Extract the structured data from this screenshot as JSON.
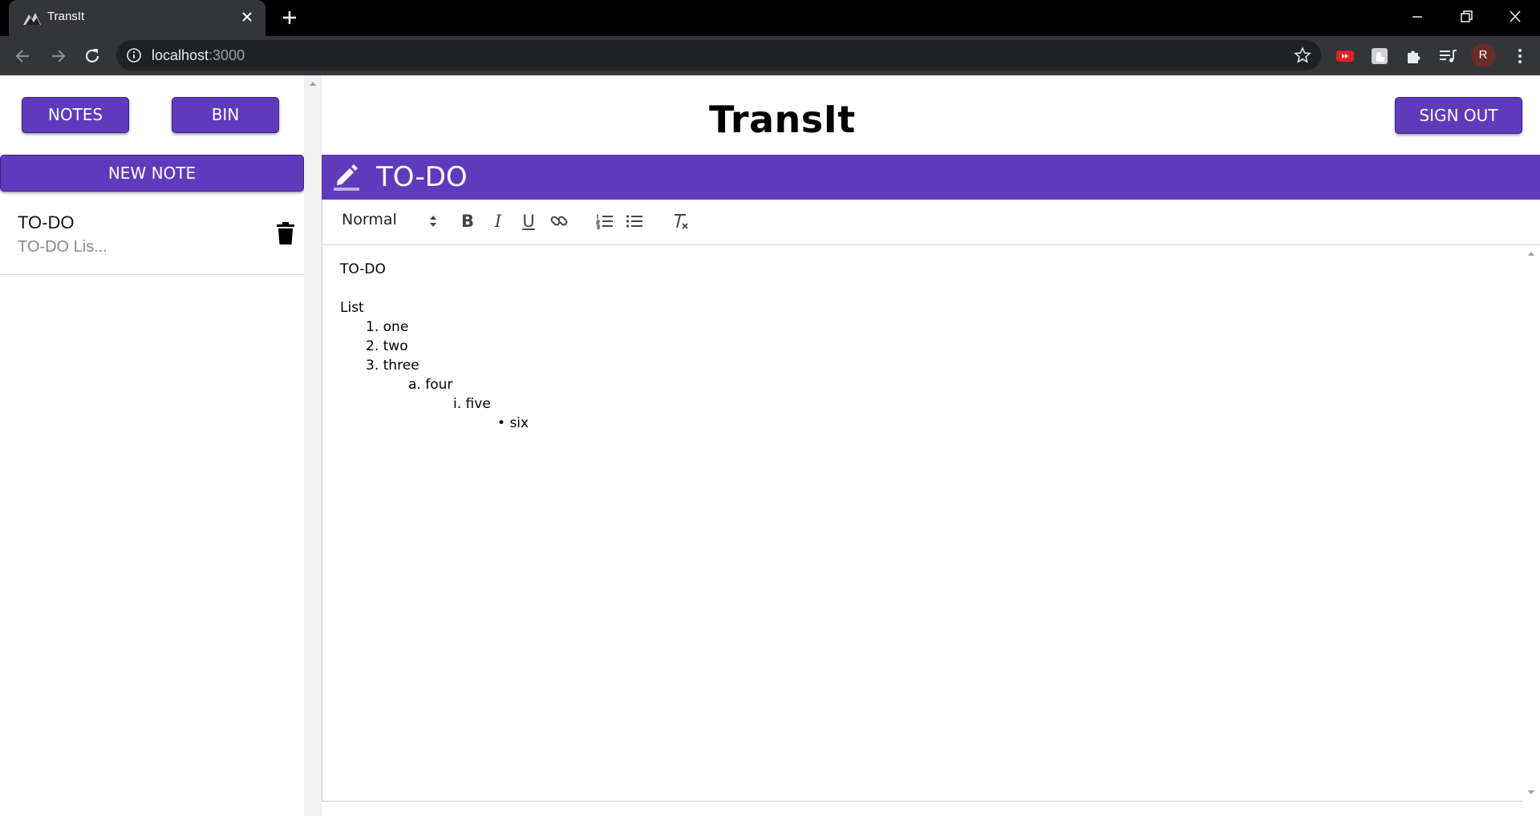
{
  "browser": {
    "tab_title": "TransIt",
    "url_host": "localhost",
    "url_port": ":3000",
    "profile_initial": "R",
    "icons": [
      "tab-favicon",
      "close-icon",
      "plus-icon",
      "minimize-icon",
      "restore-icon",
      "window-close-icon",
      "back-icon",
      "forward-icon",
      "reload-icon",
      "info-icon",
      "star-icon",
      "youtube-extension-icon",
      "extension-icon",
      "puzzle-icon",
      "media-icon",
      "kebab-menu-icon"
    ]
  },
  "app": {
    "title": "TransIt",
    "nav": {
      "notes_label": "NOTES",
      "bin_label": "BIN",
      "new_note_label": "NEW NOTE",
      "sign_out_label": "SIGN OUT"
    },
    "notes": [
      {
        "title": "TO-DO",
        "preview": "TO-DO Lis..."
      }
    ],
    "editor": {
      "note_title": "TO-DO",
      "toolbar": {
        "format_select": "Normal",
        "bold": "B",
        "italic": "I",
        "underline": "U"
      },
      "content": {
        "line1": "TO-DO",
        "line2": "List",
        "items": [
          {
            "marker": "1.",
            "text": "one"
          },
          {
            "marker": "2.",
            "text": "two"
          },
          {
            "marker": "3.",
            "text": "three"
          },
          {
            "marker": "a.",
            "text": "four"
          },
          {
            "marker": "i.",
            "text": "five"
          },
          {
            "marker": "•",
            "text": "six"
          }
        ]
      }
    },
    "colors": {
      "accent": "#5e3bbd",
      "chrome_dark": "#343538",
      "tabstrip": "#000000"
    }
  }
}
